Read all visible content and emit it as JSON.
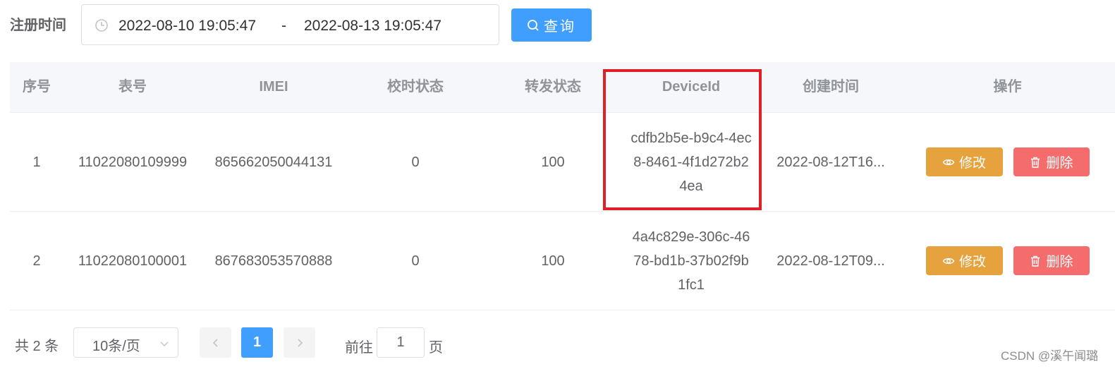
{
  "filter": {
    "label": "注册时间",
    "start": "2022-08-10 19:05:47",
    "separator": "-",
    "end": "2022-08-13 19:05:47",
    "search_label": "查询"
  },
  "table": {
    "headers": [
      "序号",
      "表号",
      "IMEI",
      "校时状态",
      "转发状态",
      "DeviceId",
      "创建时间",
      "操作"
    ],
    "rows": [
      {
        "index": "1",
        "meter": "11022080109999",
        "imei": "865662050044131",
        "check_status": "0",
        "forward_status": "100",
        "device_id": "cdfb2b5e-b9c4-4ec8-8461-4f1d272b24ea",
        "created": "2022-08-12T16..."
      },
      {
        "index": "2",
        "meter": "11022080100001",
        "imei": "867683053570888",
        "check_status": "0",
        "forward_status": "100",
        "device_id": "4a4c829e-306c-4678-bd1b-37b02f9b1fc1",
        "created": "2022-08-12T09..."
      }
    ],
    "actions": {
      "edit": "修改",
      "delete": "删除"
    }
  },
  "pagination": {
    "total": "共 2 条",
    "page_size": "10条/页",
    "current_page": "1",
    "goto_prefix": "前往",
    "goto_value": "1",
    "goto_suffix": "页"
  },
  "watermark": "CSDN @溪午闻璐",
  "colors": {
    "primary": "#409eff",
    "warning": "#e6a23c",
    "danger": "#f56c6c",
    "highlight": "#e01f26"
  }
}
